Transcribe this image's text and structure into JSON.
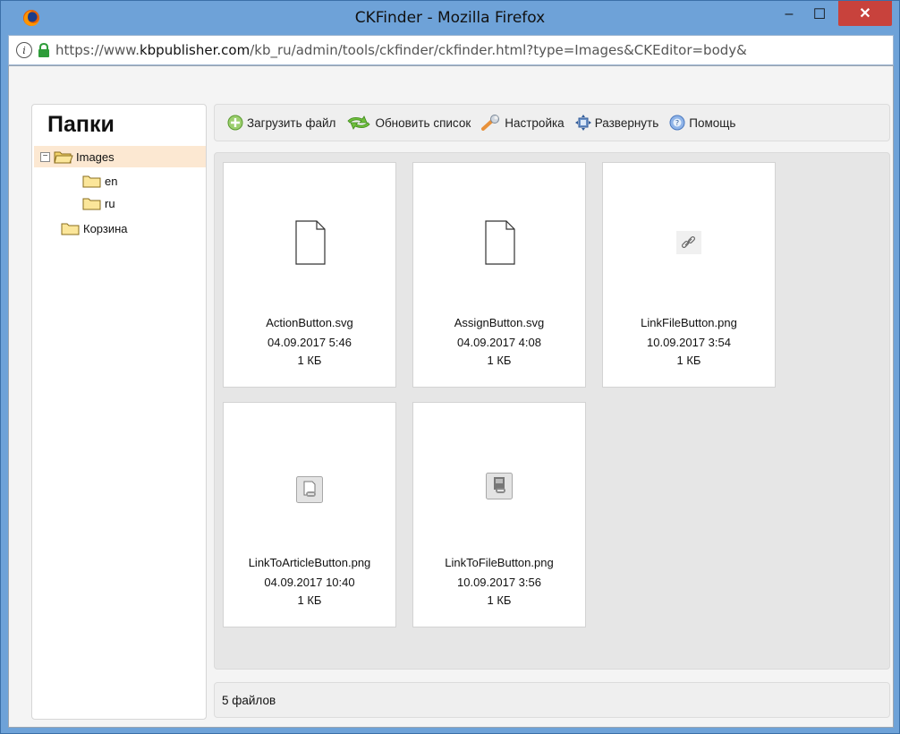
{
  "window": {
    "title": "CKFinder - Mozilla Firefox",
    "minimize": "–",
    "maximize": "☐",
    "close": "✕"
  },
  "address": {
    "prefix": "https://www.",
    "host": "kbpublisher.com",
    "path": "/kb_ru/admin/tools/ckfinder/ckfinder.html?type=Images&CKEditor=body&"
  },
  "sidebar": {
    "title": "Папки",
    "folders": [
      {
        "label": "Images",
        "toggle": "−"
      },
      {
        "label": "en"
      },
      {
        "label": "ru"
      },
      {
        "label": "Корзина"
      }
    ]
  },
  "toolbar": {
    "upload": "Загрузить файл",
    "refresh": "Обновить список",
    "settings": "Настройка",
    "maximize": "Развернуть",
    "help": "Помощь"
  },
  "files": [
    {
      "name": "ActionButton.svg",
      "date": "04.09.2017 5:46",
      "size": "1 КБ",
      "thumb": "document-icon"
    },
    {
      "name": "AssignButton.svg",
      "date": "04.09.2017 4:08",
      "size": "1 КБ",
      "thumb": "document-icon"
    },
    {
      "name": "LinkFileButton.png",
      "date": "10.09.2017 3:54",
      "size": "1 КБ",
      "thumb": "link-icon"
    },
    {
      "name": "LinkToArticleButton.png",
      "date": "04.09.2017 10:40",
      "size": "1 КБ",
      "thumb": "article-link-icon"
    },
    {
      "name": "LinkToFileButton.png",
      "date": "10.09.2017 3:56",
      "size": "1 КБ",
      "thumb": "file-link-icon"
    }
  ],
  "status": {
    "text": "5 файлов"
  },
  "colors": {
    "titlebar": "#6ea2d8",
    "close_button": "#c8423c",
    "selected_folder": "#fce8d2"
  }
}
